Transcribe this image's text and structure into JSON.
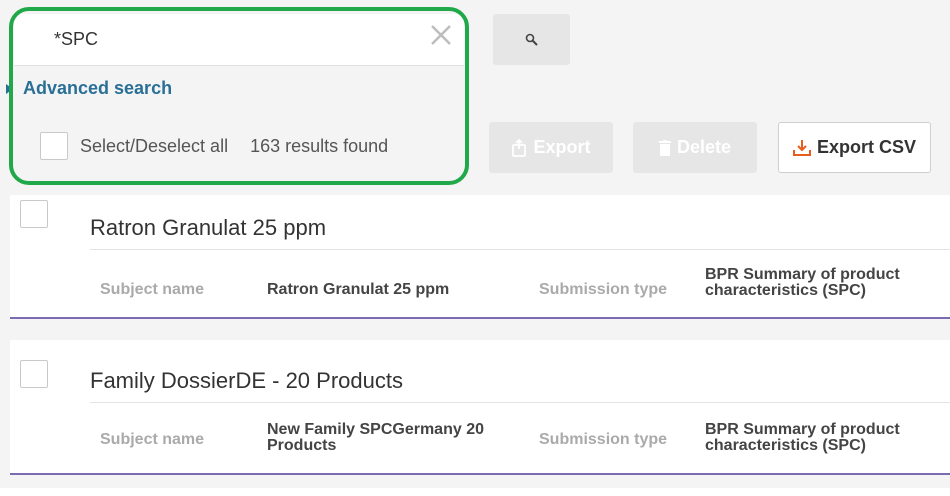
{
  "search": {
    "query": "*SPC"
  },
  "advanced_search_label": "Advanced search",
  "select_all_label": "Select/Deselect all",
  "results_count": "163 results found",
  "toolbar": {
    "export_label": "Export",
    "delete_label": "Delete",
    "export_csv_label": "Export CSV"
  },
  "colors": {
    "accent": "#2a6f96",
    "highlight": "#21a84a",
    "card_border": "#7b6bb3",
    "csv_icon": "#e85d1a"
  },
  "results": [
    {
      "title": "Ratron Granulat 25 ppm",
      "subject_label": "Subject name",
      "subject_value": "Ratron Granulat 25 ppm",
      "submission_label": "Submission type",
      "submission_value_1": "BPR Summary of product",
      "submission_value_2": "characteristics (SPC)"
    },
    {
      "title": "Family DossierDE - 20 Products",
      "subject_label": "Subject name",
      "subject_value_1": "New Family SPCGermany 20",
      "subject_value_2": "Products",
      "submission_label": "Submission type",
      "submission_value_1": "BPR Summary of product",
      "submission_value_2": "characteristics (SPC)"
    }
  ]
}
